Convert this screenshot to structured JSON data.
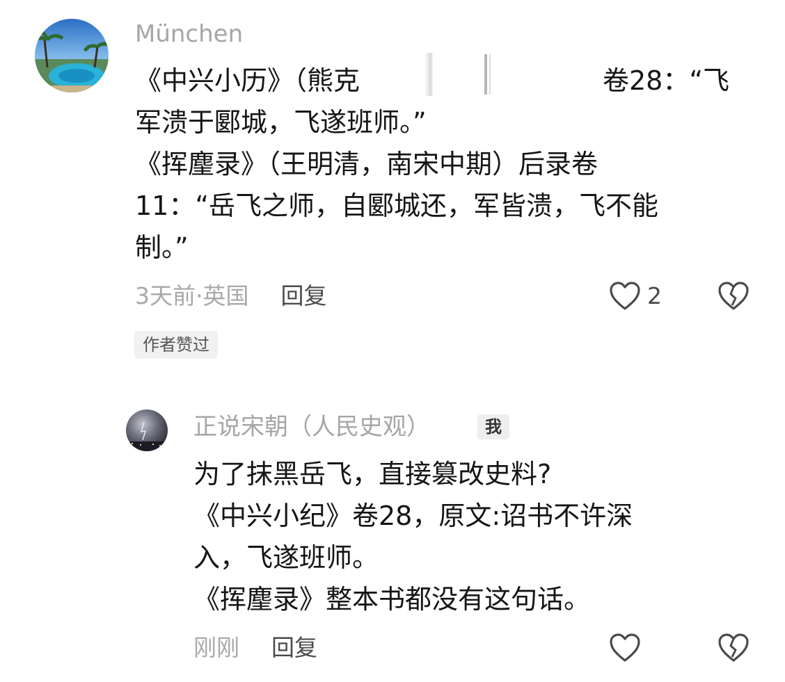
{
  "comments": [
    {
      "username": "München",
      "lines": [
        "《中兴小历》（熊克",
        "卷28：“飞",
        "军溃于郾城，飞遂班师。”",
        "《挥麈录》（王明清，南宋中期）后录卷",
        "11：“岳飞之师，自郾城还，军皆溃，飞不能",
        "制。”"
      ],
      "time": "3天前·英国",
      "reply_label": "回复",
      "like_count": "2",
      "badge": "作者赞过"
    }
  ],
  "replies": [
    {
      "username": "正说宋朝（人民史观）",
      "me_badge": "我",
      "lines": [
        "为了抹黑岳飞，直接篡改史料?",
        "《中兴小纪》卷28，原文:诏书不许深",
        "入，飞遂班师。",
        "《挥麈录》整本书都没有这句话。"
      ],
      "time": "刚刚",
      "reply_label": "回复"
    }
  ],
  "icons": {
    "like": "heart-outline-icon",
    "dislike": "broken-heart-icon"
  }
}
